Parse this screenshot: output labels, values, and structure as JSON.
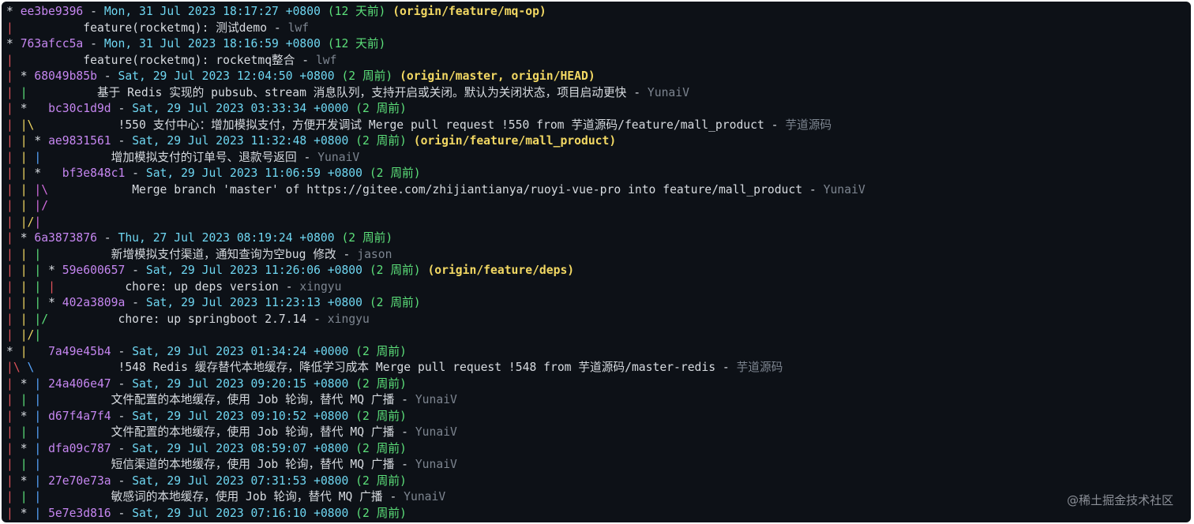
{
  "colors": {
    "background": "#0d1117",
    "hash": "#c586f0",
    "date": "#6fd7f2",
    "relative": "#5ce07a",
    "refs": "#f2d863",
    "author": "#7d8590",
    "graph_red": "#e0525a",
    "graph_green": "#5ce07a",
    "graph_yellow": "#f2d863",
    "graph_blue": "#58a6ff",
    "graph_magenta": "#d46de0",
    "graph_cyan": "#56d4dd",
    "graph_white": "#d7dbe0"
  },
  "watermark": "@稀土掘金技术社区",
  "lines": [
    {
      "type": "commit",
      "graph": [
        {
          "t": "* ",
          "c": "graph_white"
        }
      ],
      "pad": "",
      "hash": "ee3be9396",
      "date": "Mon, 31 Jul 2023 18:17:27 +0800",
      "rel": "(12 天前)",
      "refs": "(origin/feature/mq-op)"
    },
    {
      "type": "message",
      "graph": [
        {
          "t": "|",
          "c": "graph_red"
        }
      ],
      "pad": "          ",
      "subject": "feature(rocketmq): 测试demo",
      "author": "lwf"
    },
    {
      "type": "commit",
      "graph": [
        {
          "t": "* ",
          "c": "graph_white"
        }
      ],
      "pad": "",
      "hash": "763afcc5a",
      "date": "Mon, 31 Jul 2023 18:16:59 +0800",
      "rel": "(12 天前)",
      "refs": ""
    },
    {
      "type": "message",
      "graph": [
        {
          "t": "|",
          "c": "graph_red"
        }
      ],
      "pad": "          ",
      "subject": "feature(rocketmq): rocketmq整合",
      "author": "lwf"
    },
    {
      "type": "commit",
      "graph": [
        {
          "t": "| ",
          "c": "graph_red"
        },
        {
          "t": "* ",
          "c": "graph_white"
        }
      ],
      "pad": "",
      "hash": "68049b85b",
      "date": "Sat, 29 Jul 2023 12:04:50 +0800",
      "rel": "(2 周前)",
      "refs": "(origin/master, origin/HEAD)"
    },
    {
      "type": "message",
      "graph": [
        {
          "t": "| ",
          "c": "graph_red"
        },
        {
          "t": "|",
          "c": "graph_green"
        }
      ],
      "pad": "          ",
      "subject": "基于 Redis 实现的 pubsub、stream 消息队列，支持开启或关闭。默认为关闭状态，项目启动更快",
      "author": "YunaiV"
    },
    {
      "type": "commit",
      "graph": [
        {
          "t": "| ",
          "c": "graph_red"
        },
        {
          "t": "*   ",
          "c": "graph_white"
        }
      ],
      "pad": "",
      "hash": "bc30c1d9d",
      "date": "Sat, 29 Jul 2023 03:33:34 +0000",
      "rel": "(2 周前)",
      "refs": ""
    },
    {
      "type": "message",
      "graph": [
        {
          "t": "| ",
          "c": "graph_red"
        },
        {
          "t": "|\\",
          "c": "graph_yellow"
        }
      ],
      "pad": "            ",
      "subject": "!550 支付中心：增加模拟支付，方便开发调试 Merge pull request !550 from 芋道源码/feature/mall_product",
      "author": "芋道源码"
    },
    {
      "type": "commit",
      "graph": [
        {
          "t": "| ",
          "c": "graph_red"
        },
        {
          "t": "| ",
          "c": "graph_yellow"
        },
        {
          "t": "* ",
          "c": "graph_white"
        }
      ],
      "pad": "",
      "hash": "ae9831561",
      "date": "Sat, 29 Jul 2023 11:32:48 +0800",
      "rel": "(2 周前)",
      "refs": "(origin/feature/mall_product)"
    },
    {
      "type": "message",
      "graph": [
        {
          "t": "| ",
          "c": "graph_red"
        },
        {
          "t": "| ",
          "c": "graph_yellow"
        },
        {
          "t": "|",
          "c": "graph_blue"
        }
      ],
      "pad": "          ",
      "subject": "增加模拟支付的订单号、退款号返回",
      "author": "YunaiV"
    },
    {
      "type": "commit",
      "graph": [
        {
          "t": "| ",
          "c": "graph_red"
        },
        {
          "t": "| ",
          "c": "graph_yellow"
        },
        {
          "t": "*   ",
          "c": "graph_white"
        }
      ],
      "pad": "",
      "hash": "bf3e848c1",
      "date": "Sat, 29 Jul 2023 11:06:59 +0800",
      "rel": "(2 周前)",
      "refs": ""
    },
    {
      "type": "message",
      "graph": [
        {
          "t": "| ",
          "c": "graph_red"
        },
        {
          "t": "| ",
          "c": "graph_yellow"
        },
        {
          "t": "|\\",
          "c": "graph_magenta"
        }
      ],
      "pad": "            ",
      "subject": "Merge branch 'master' of https://gitee.com/zhijiantianya/ruoyi-vue-pro into feature/mall_product",
      "author": "YunaiV"
    },
    {
      "type": "graph",
      "graph": [
        {
          "t": "| ",
          "c": "graph_red"
        },
        {
          "t": "| ",
          "c": "graph_yellow"
        },
        {
          "t": "|/",
          "c": "graph_magenta"
        }
      ]
    },
    {
      "type": "graph",
      "graph": [
        {
          "t": "| ",
          "c": "graph_red"
        },
        {
          "t": "|/",
          "c": "graph_yellow"
        },
        {
          "t": "|",
          "c": "graph_magenta"
        }
      ]
    },
    {
      "type": "commit",
      "graph": [
        {
          "t": "| ",
          "c": "graph_red"
        },
        {
          "t": "* ",
          "c": "graph_white"
        }
      ],
      "pad": "",
      "hash": "6a3873876",
      "date": "Thu, 27 Jul 2023 08:19:24 +0800",
      "rel": "(2 周前)",
      "refs": ""
    },
    {
      "type": "message",
      "graph": [
        {
          "t": "| ",
          "c": "graph_red"
        },
        {
          "t": "| ",
          "c": "graph_yellow"
        },
        {
          "t": "|",
          "c": "graph_green"
        }
      ],
      "pad": "          ",
      "subject": "新增模拟支付渠道，通知查询为空bug 修改",
      "author": "jason"
    },
    {
      "type": "commit",
      "graph": [
        {
          "t": "| ",
          "c": "graph_red"
        },
        {
          "t": "| ",
          "c": "graph_yellow"
        },
        {
          "t": "| ",
          "c": "graph_green"
        },
        {
          "t": "* ",
          "c": "graph_white"
        }
      ],
      "pad": "",
      "hash": "59e600657",
      "date": "Sat, 29 Jul 2023 11:26:06 +0800",
      "rel": "(2 周前)",
      "refs": "(origin/feature/deps)"
    },
    {
      "type": "message",
      "graph": [
        {
          "t": "| ",
          "c": "graph_red"
        },
        {
          "t": "| ",
          "c": "graph_yellow"
        },
        {
          "t": "| ",
          "c": "graph_green"
        },
        {
          "t": "|",
          "c": "graph_red"
        }
      ],
      "pad": "          ",
      "subject": "chore: up deps version",
      "author": "xingyu"
    },
    {
      "type": "commit",
      "graph": [
        {
          "t": "| ",
          "c": "graph_red"
        },
        {
          "t": "| ",
          "c": "graph_yellow"
        },
        {
          "t": "| ",
          "c": "graph_green"
        },
        {
          "t": "* ",
          "c": "graph_white"
        }
      ],
      "pad": "",
      "hash": "402a3809a",
      "date": "Sat, 29 Jul 2023 11:23:13 +0800",
      "rel": "(2 周前)",
      "refs": ""
    },
    {
      "type": "message",
      "graph": [
        {
          "t": "| ",
          "c": "graph_red"
        },
        {
          "t": "| ",
          "c": "graph_yellow"
        },
        {
          "t": "|/",
          "c": "graph_green"
        }
      ],
      "pad": "          ",
      "subject": "chore: up springboot 2.7.14",
      "author": "xingyu"
    },
    {
      "type": "graph",
      "graph": [
        {
          "t": "| ",
          "c": "graph_red"
        },
        {
          "t": "|/",
          "c": "graph_yellow"
        },
        {
          "t": "|",
          "c": "graph_green"
        }
      ]
    },
    {
      "type": "commit",
      "graph": [
        {
          "t": "* ",
          "c": "graph_white"
        },
        {
          "t": "|   ",
          "c": "graph_yellow"
        }
      ],
      "pad": "",
      "hash": "7a49e45b4",
      "date": "Sat, 29 Jul 2023 01:34:24 +0000",
      "rel": "(2 周前)",
      "refs": ""
    },
    {
      "type": "message",
      "graph": [
        {
          "t": "|\\",
          "c": "graph_red"
        },
        {
          "t": " \\",
          "c": "graph_blue"
        }
      ],
      "pad": "            ",
      "subject": "!548 Redis 缓存替代本地缓存，降低学习成本 Merge pull request !548 from 芋道源码/master-redis",
      "author": "芋道源码"
    },
    {
      "type": "commit",
      "graph": [
        {
          "t": "| ",
          "c": "graph_red"
        },
        {
          "t": "* ",
          "c": "graph_white"
        },
        {
          "t": "| ",
          "c": "graph_blue"
        }
      ],
      "pad": "",
      "hash": "24a406e47",
      "date": "Sat, 29 Jul 2023 09:20:15 +0800",
      "rel": "(2 周前)",
      "refs": ""
    },
    {
      "type": "message",
      "graph": [
        {
          "t": "| ",
          "c": "graph_red"
        },
        {
          "t": "| ",
          "c": "graph_green"
        },
        {
          "t": "|",
          "c": "graph_blue"
        }
      ],
      "pad": "          ",
      "subject": "文件配置的本地缓存，使用 Job 轮询，替代 MQ 广播",
      "author": "YunaiV"
    },
    {
      "type": "commit",
      "graph": [
        {
          "t": "| ",
          "c": "graph_red"
        },
        {
          "t": "* ",
          "c": "graph_white"
        },
        {
          "t": "| ",
          "c": "graph_blue"
        }
      ],
      "pad": "",
      "hash": "d67f4a7f4",
      "date": "Sat, 29 Jul 2023 09:10:52 +0800",
      "rel": "(2 周前)",
      "refs": ""
    },
    {
      "type": "message",
      "graph": [
        {
          "t": "| ",
          "c": "graph_red"
        },
        {
          "t": "| ",
          "c": "graph_green"
        },
        {
          "t": "|",
          "c": "graph_blue"
        }
      ],
      "pad": "          ",
      "subject": "文件配置的本地缓存，使用 Job 轮询，替代 MQ 广播",
      "author": "YunaiV"
    },
    {
      "type": "commit",
      "graph": [
        {
          "t": "| ",
          "c": "graph_red"
        },
        {
          "t": "* ",
          "c": "graph_white"
        },
        {
          "t": "| ",
          "c": "graph_blue"
        }
      ],
      "pad": "",
      "hash": "dfa09c787",
      "date": "Sat, 29 Jul 2023 08:59:07 +0800",
      "rel": "(2 周前)",
      "refs": ""
    },
    {
      "type": "message",
      "graph": [
        {
          "t": "| ",
          "c": "graph_red"
        },
        {
          "t": "| ",
          "c": "graph_green"
        },
        {
          "t": "|",
          "c": "graph_blue"
        }
      ],
      "pad": "          ",
      "subject": "短信渠道的本地缓存，使用 Job 轮询，替代 MQ 广播",
      "author": "YunaiV"
    },
    {
      "type": "commit",
      "graph": [
        {
          "t": "| ",
          "c": "graph_red"
        },
        {
          "t": "* ",
          "c": "graph_white"
        },
        {
          "t": "| ",
          "c": "graph_blue"
        }
      ],
      "pad": "",
      "hash": "27e70e73a",
      "date": "Sat, 29 Jul 2023 07:31:53 +0800",
      "rel": "(2 周前)",
      "refs": ""
    },
    {
      "type": "message",
      "graph": [
        {
          "t": "| ",
          "c": "graph_red"
        },
        {
          "t": "| ",
          "c": "graph_green"
        },
        {
          "t": "|",
          "c": "graph_blue"
        }
      ],
      "pad": "          ",
      "subject": "敏感词的本地缓存，使用 Job 轮询，替代 MQ 广播",
      "author": "YunaiV"
    },
    {
      "type": "commit",
      "graph": [
        {
          "t": "| ",
          "c": "graph_red"
        },
        {
          "t": "* ",
          "c": "graph_white"
        },
        {
          "t": "| ",
          "c": "graph_blue"
        }
      ],
      "pad": "",
      "hash": "5e7e3d816",
      "date": "Sat, 29 Jul 2023 07:16:10 +0800",
      "rel": "(2 周前)",
      "refs": ""
    }
  ]
}
